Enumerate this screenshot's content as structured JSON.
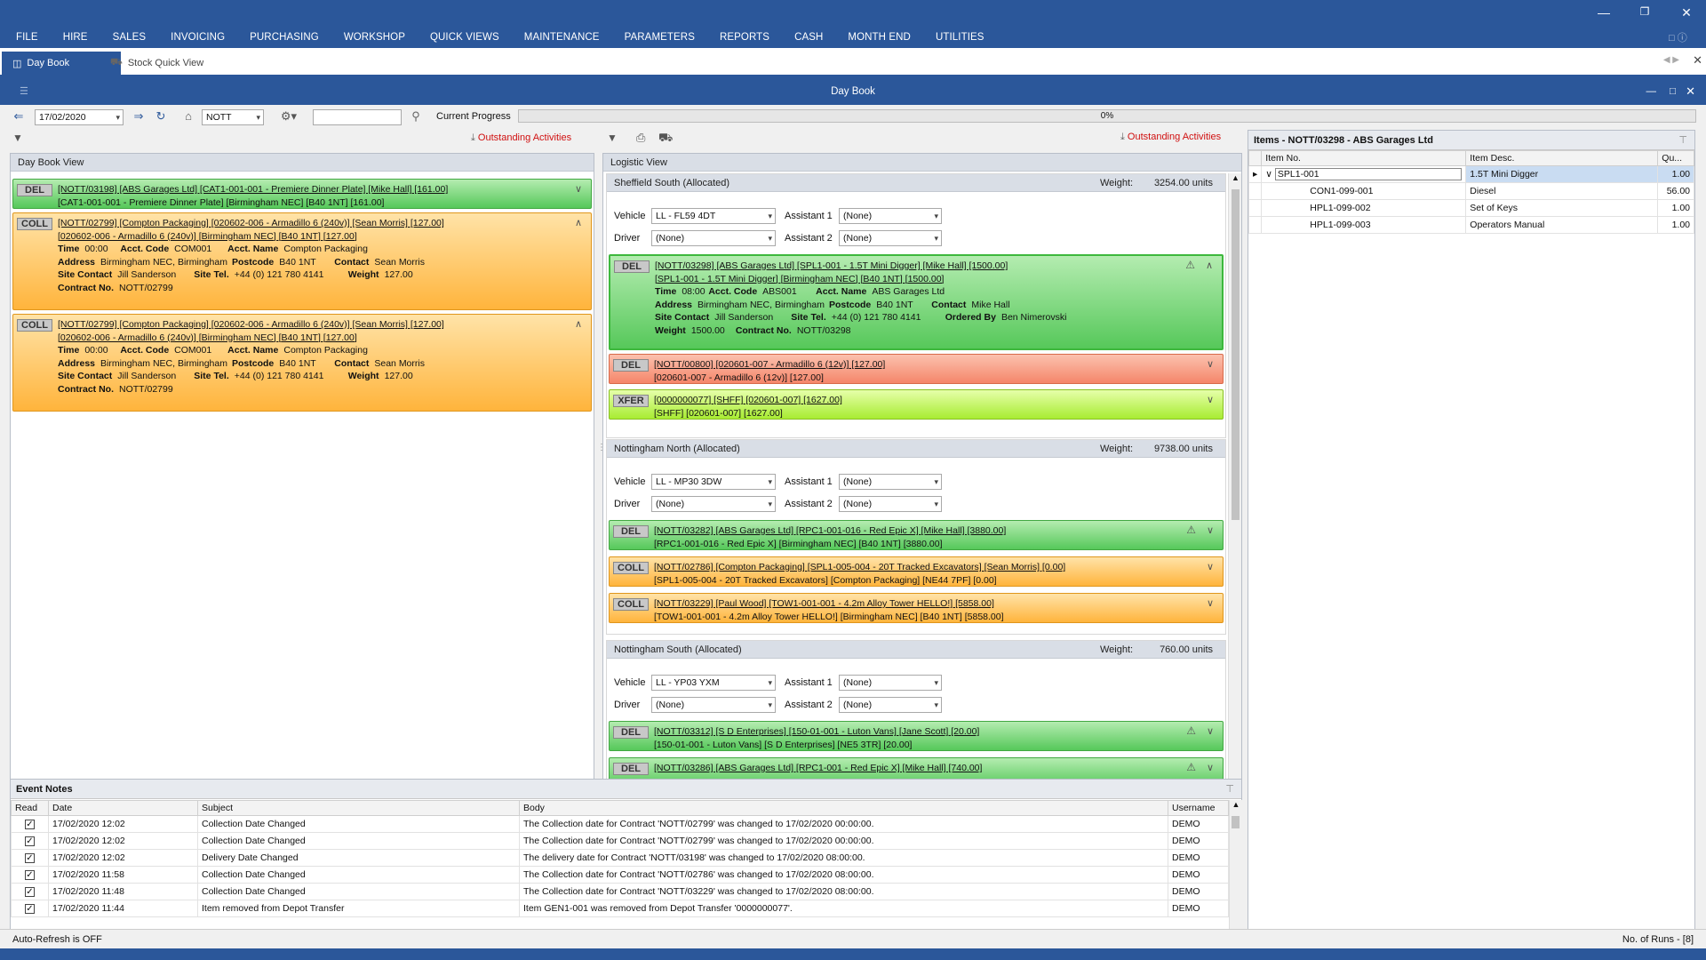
{
  "menu": [
    "FILE",
    "HIRE",
    "SALES",
    "INVOICING",
    "PURCHASING",
    "WORKSHOP",
    "QUICK VIEWS",
    "MAINTENANCE",
    "PARAMETERS",
    "REPORTS",
    "CASH",
    "MONTH END",
    "UTILITIES"
  ],
  "tabs": {
    "day_book": "Day Book",
    "stock_quick_view": "Stock Quick View"
  },
  "panel_title": "Day Book",
  "toolbar": {
    "date": "17/02/2020",
    "depot": "NOTT",
    "search": "",
    "progress_label": "Current Progress",
    "progress_pct": "0%",
    "progress_value": 0
  },
  "outstanding": "Outstanding Activities",
  "daybook": {
    "title": "Day Book View",
    "cards": [
      {
        "type": "DEL",
        "color": "green",
        "line1": "[NOTT/03198] [ABS Garages Ltd] [CAT1-001-001 - Premiere Dinner Plate] [Mike Hall] [161.00]",
        "line2": "[CAT1-001-001 - Premiere Dinner Plate] [Birmingham NEC] [B40 1NT] [161.00]"
      },
      {
        "type": "COLL",
        "color": "orange",
        "line1": "[NOTT/02799] [Compton Packaging] [020602-006 - Armadillo 6 (240v)] [Sean Morris] [127.00]",
        "line2": "[020602-006 - Armadillo 6 (240v)] [Birmingham NEC] [B40 1NT] [127.00]",
        "time_l": "Time",
        "time": "00:00",
        "acct_code_l": "Acct. Code",
        "acct_code": "COM001",
        "acct_name_l": "Acct. Name",
        "acct_name": "Compton Packaging",
        "address_l": "Address",
        "address": "Birmingham NEC, Birmingham",
        "postcode_l": "Postcode",
        "postcode": "B40 1NT",
        "contact_l": "Contact",
        "contact": "Sean Morris",
        "site_contact_l": "Site Contact",
        "site_contact": "Jill Sanderson",
        "site_tel_l": "Site Tel.",
        "site_tel": "+44 (0) 121 780 4141",
        "weight_l": "Weight",
        "weight": "127.00",
        "contract_l": "Contract No.",
        "contract": "NOTT/02799"
      },
      {
        "type": "COLL",
        "color": "orange",
        "line1": "[NOTT/02799] [Compton Packaging] [020602-006 - Armadillo 6 (240v)] [Sean Morris] [127.00]",
        "line2": "[020602-006 - Armadillo 6 (240v)] [Birmingham NEC] [B40 1NT] [127.00]",
        "time_l": "Time",
        "time": "00:00",
        "acct_code_l": "Acct. Code",
        "acct_code": "COM001",
        "acct_name_l": "Acct. Name",
        "acct_name": "Compton Packaging",
        "address_l": "Address",
        "address": "Birmingham NEC, Birmingham",
        "postcode_l": "Postcode",
        "postcode": "B40 1NT",
        "contact_l": "Contact",
        "contact": "Sean Morris",
        "site_contact_l": "Site Contact",
        "site_contact": "Jill Sanderson",
        "site_tel_l": "Site Tel.",
        "site_tel": "+44 (0) 121 780 4141",
        "weight_l": "Weight",
        "weight": "127.00",
        "contract_l": "Contract No.",
        "contract": "NOTT/02799"
      }
    ]
  },
  "logistic": {
    "title": "Logistic View",
    "weight_label": "Weight:",
    "vehicle_label": "Vehicle",
    "driver_label": "Driver",
    "asst1_label": "Assistant 1",
    "asst2_label": "Assistant 2",
    "runs": [
      {
        "name": "Sheffield South (Allocated)",
        "weight": "3254.00 units",
        "vehicle": "LL - FL59 4DT",
        "driver": "(None)",
        "asst1": "(None)",
        "asst2": "(None)"
      },
      {
        "name": "Nottingham North (Allocated)",
        "weight": "9738.00 units",
        "vehicle": "LL - MP30 3DW",
        "driver": "(None)",
        "asst1": "(None)",
        "asst2": "(None)"
      },
      {
        "name": "Nottingham South (Allocated)",
        "weight": "760.00 units",
        "vehicle": "LL - YP03 YXM",
        "driver": "(None)",
        "asst1": "(None)",
        "asst2": "(None)"
      }
    ],
    "sel": {
      "type": "DEL",
      "line1": "[NOTT/03298] [ABS Garages Ltd] [SPL1-001 - 1.5T Mini Digger] [Mike Hall] [1500.00]",
      "line2": "[SPL1-001 - 1.5T Mini Digger] [Birmingham NEC] [B40 1NT] [1500.00]",
      "time_l": "Time",
      "time": "08:00",
      "acct_code_l": "Acct. Code",
      "acct_code": "ABS001",
      "acct_name_l": "Acct. Name",
      "acct_name": "ABS Garages Ltd",
      "address_l": "Address",
      "address": "Birmingham NEC, Birmingham",
      "postcode_l": "Postcode",
      "postcode": "B40 1NT",
      "contact_l": "Contact",
      "contact": "Mike Hall",
      "site_contact_l": "Site Contact",
      "site_contact": "Jill Sanderson",
      "site_tel_l": "Site Tel.",
      "site_tel": "+44 (0) 121 780 4141",
      "ordered_l": "Ordered By",
      "ordered": "Ben Nimerovski",
      "weight_l": "Weight",
      "weight": "1500.00",
      "contract_l": "Contract No.",
      "contract": "NOTT/03298"
    },
    "c1": {
      "type": "DEL",
      "line1": "[NOTT/00800] [020601-007 - Armadillo 6 (12v)] [127.00]",
      "line2": "[020601-007 - Armadillo 6 (12v)] [127.00]"
    },
    "c2": {
      "type": "XFER",
      "line1": "[0000000077] [SHFF] [020601-007] [1627.00]",
      "line2": "[SHFF] [020601-007] [1627.00]"
    },
    "c3": {
      "type": "DEL",
      "line1": "[NOTT/03282] [ABS Garages Ltd] [RPC1-001-016 - Red Epic X] [Mike Hall] [3880.00]",
      "line2": "[RPC1-001-016 - Red Epic X] [Birmingham NEC] [B40 1NT] [3880.00]"
    },
    "c4": {
      "type": "COLL",
      "line1": "[NOTT/02786] [Compton Packaging] [SPL1-005-004 - 20T Tracked Excavators] [Sean Morris] [0.00]",
      "line2": "[SPL1-005-004 - 20T Tracked Excavators] [Compton Packaging] [NE44 7PF] [0.00]"
    },
    "c5": {
      "type": "COLL",
      "line1": "[NOTT/03229] [Paul Wood] [TOW1-001-001 - 4.2m Alloy Tower HELLO!] [5858.00]",
      "line2": "[TOW1-001-001 - 4.2m Alloy Tower HELLO!] [Birmingham NEC] [B40 1NT] [5858.00]"
    },
    "c6": {
      "type": "DEL",
      "line1": "[NOTT/03312] [S D Enterprises] [150-01-001 - Luton Vans] [Jane Scott] [20.00]",
      "line2": "[150-01-001 - Luton Vans] [S D Enterprises] [NE5 3TR] [20.00]"
    },
    "c7": {
      "type": "DEL",
      "line1": "[NOTT/03286] [ABS Garages Ltd] [RPC1-001 - Red Epic X] [Mike Hall] [740.00]"
    }
  },
  "items": {
    "title": "Items - NOTT/03298 - ABS Garages Ltd",
    "cols": [
      "Item No.",
      "Item Desc.",
      "Qu..."
    ],
    "rows": [
      {
        "no": "SPL1-001",
        "desc": "1.5T Mini Digger",
        "qty": "1.00"
      },
      {
        "no": "CON1-099-001",
        "desc": "Diesel",
        "qty": "56.00"
      },
      {
        "no": "HPL1-099-002",
        "desc": "Set of Keys",
        "qty": "1.00"
      },
      {
        "no": "HPL1-099-003",
        "desc": "Operators Manual",
        "qty": "1.00"
      }
    ]
  },
  "events": {
    "title": "Event Notes",
    "cols": [
      "Read",
      "Date",
      "Subject",
      "Body",
      "Username"
    ],
    "rows": [
      {
        "date": "17/02/2020 12:02",
        "subject": "Collection Date Changed",
        "body": "The Collection date for Contract 'NOTT/02799' was changed to 17/02/2020 00:00:00.",
        "user": "DEMO"
      },
      {
        "date": "17/02/2020 12:02",
        "subject": "Collection Date Changed",
        "body": "The Collection date for Contract 'NOTT/02799' was changed to 17/02/2020 00:00:00.",
        "user": "DEMO"
      },
      {
        "date": "17/02/2020 12:02",
        "subject": "Delivery Date Changed",
        "body": "The delivery date for Contract 'NOTT/03198' was changed to 17/02/2020 08:00:00.",
        "user": "DEMO"
      },
      {
        "date": "17/02/2020 11:58",
        "subject": "Collection Date Changed",
        "body": "The Collection date for Contract 'NOTT/02786' was changed to 17/02/2020 08:00:00.",
        "user": "DEMO"
      },
      {
        "date": "17/02/2020 11:48",
        "subject": "Collection Date Changed",
        "body": "The Collection date for Contract 'NOTT/03229' was changed to 17/02/2020 08:00:00.",
        "user": "DEMO"
      },
      {
        "date": "17/02/2020 11:44",
        "subject": "Item removed from Depot Transfer",
        "body": "Item GEN1-001 was removed from Depot Transfer '0000000077'.",
        "user": "DEMO"
      }
    ]
  },
  "status": {
    "left": "Auto-Refresh is OFF",
    "right": "No. of Runs - [8]"
  }
}
